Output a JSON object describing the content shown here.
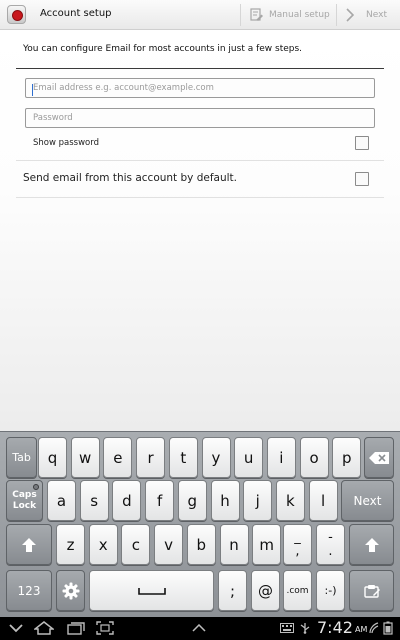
{
  "action_bar": {
    "title": "Account setup",
    "manual_setup_label": "Manual setup",
    "next_label": "Next",
    "icons": {
      "app": "email-app-icon",
      "manual": "manual-setup-icon",
      "next": "chevron-right-icon"
    }
  },
  "content": {
    "intro": "You can configure Email for most accounts in just a few steps.",
    "email_field": {
      "value": "",
      "placeholder": "Email address e.g. account@example.com"
    },
    "password_field": {
      "value": "",
      "placeholder": "Password"
    },
    "show_password_label": "Show password",
    "show_password_checked": false,
    "default_account_label": "Send email from this account by default.",
    "default_account_checked": false
  },
  "keyboard": {
    "tab": "Tab",
    "row1": [
      "q",
      "w",
      "e",
      "r",
      "t",
      "y",
      "u",
      "i",
      "o",
      "p"
    ],
    "caps_line1": "Caps",
    "caps_line2": "Lock",
    "row2": [
      "a",
      "s",
      "d",
      "f",
      "g",
      "h",
      "j",
      "k",
      "l"
    ],
    "next": "Next",
    "row3": [
      "z",
      "x",
      "c",
      "v",
      "b",
      "n",
      "m"
    ],
    "underscore_top": "_",
    "underscore_bottom": ",",
    "dash_top": "-",
    "dash_bottom": ".",
    "num": "123",
    "semicolon": ";",
    "at": "@",
    "dotcom": ".com",
    "smiley": ":-)",
    "icons": {
      "backspace": "backspace-icon",
      "shift": "shift-icon",
      "settings": "gear-icon",
      "space": "space-icon",
      "clipboard": "clipboard-icon"
    }
  },
  "nav_bar": {
    "time": "7:42",
    "ampm": "AM",
    "icons": [
      "hide-keyboard-icon",
      "home-icon",
      "recent-apps-icon",
      "screenshot-icon",
      "menu-up-icon",
      "keyboard-status-icon",
      "usb-icon",
      "wifi-icon",
      "signal-icon",
      "battery-icon"
    ]
  },
  "colors": {
    "caret": "#2e6fd0",
    "app_icon_red": "#c8171c",
    "disabled_text": "#a7a7a7"
  }
}
